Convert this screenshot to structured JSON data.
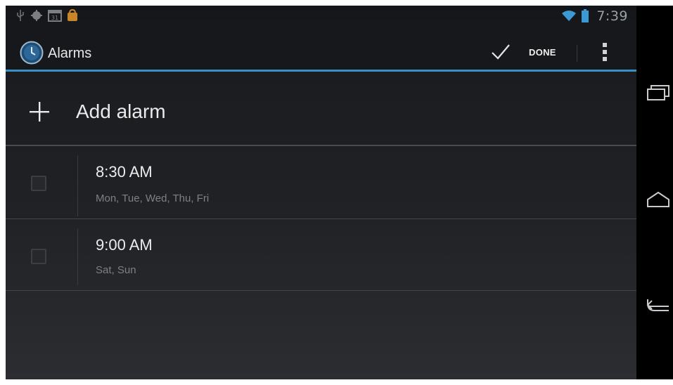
{
  "status_bar": {
    "time": "7:39",
    "left_icons": [
      "usb-icon",
      "android-debug-icon",
      "calendar-icon",
      "shop-bag-icon"
    ],
    "right_icons": [
      "wifi-icon",
      "battery-icon"
    ]
  },
  "action_bar": {
    "title": "Alarms",
    "done_label": "DONE",
    "app_icon": "clock-icon",
    "overflow_icon": "overflow-menu-icon"
  },
  "add_alarm": {
    "label": "Add alarm",
    "icon": "plus-icon"
  },
  "alarms": [
    {
      "time": "8:30 AM",
      "days": "Mon, Tue, Wed, Thu, Fri",
      "enabled": false
    },
    {
      "time": "9:00 AM",
      "days": "Sat, Sun",
      "enabled": false
    }
  ],
  "nav_bar": {
    "icons": [
      "recent-apps-icon",
      "home-icon",
      "back-icon"
    ]
  },
  "colors": {
    "accent": "#3a8fc3",
    "background": "#1a1c20",
    "text_primary": "#ececec",
    "text_secondary": "#7d8084"
  }
}
